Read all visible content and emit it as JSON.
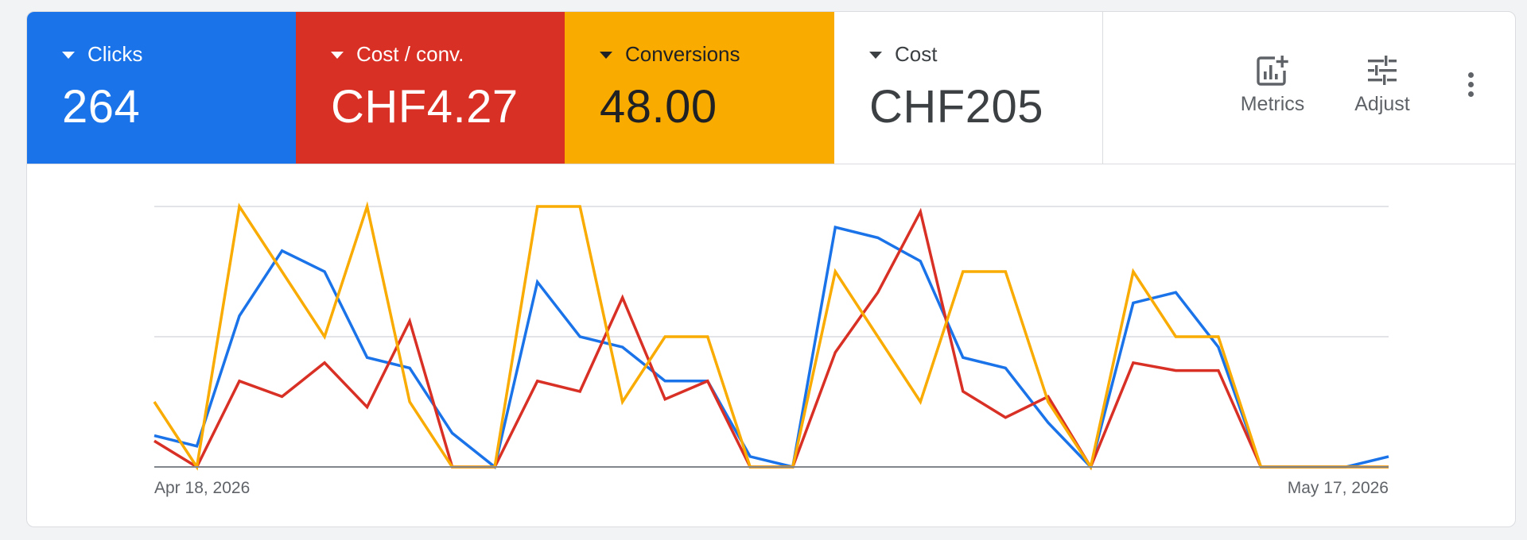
{
  "metrics": [
    {
      "label": "Clicks",
      "value": "264",
      "bg": "#1a73e8",
      "fg": "#ffffff"
    },
    {
      "label": "Cost / conv.",
      "value": "CHF4.27",
      "bg": "#d93025",
      "fg": "#ffffff"
    },
    {
      "label": "Conversions",
      "value": "48.00",
      "bg": "#f9ab00",
      "fg": "#202124"
    },
    {
      "label": "Cost",
      "value": "CHF205",
      "bg": "#ffffff",
      "fg": "#3c4043"
    }
  ],
  "actions": {
    "metrics_label": "Metrics",
    "adjust_label": "Adjust",
    "metrics_icon": "add-chart-icon",
    "adjust_icon": "tune-icon",
    "more_icon": "more-vert-icon"
  },
  "chart_data": {
    "type": "line",
    "x_start_label": "Apr 18, 2026",
    "x_end_label": "May 17, 2026",
    "ylim": [
      0,
      1
    ],
    "grid": true,
    "y_tick_labels": false,
    "series": [
      {
        "color": "#1a73e8",
        "values": [
          0.12,
          0.08,
          0.58,
          0.83,
          0.75,
          0.42,
          0.38,
          0.13,
          0.0,
          0.71,
          0.5,
          0.46,
          0.33,
          0.33,
          0.04,
          0.0,
          0.92,
          0.88,
          0.79,
          0.42,
          0.38,
          0.17,
          0.0,
          0.63,
          0.67,
          0.46,
          0.0,
          0.0,
          0.0,
          0.04
        ]
      },
      {
        "color": "#d93025",
        "values": [
          0.1,
          0.0,
          0.33,
          0.27,
          0.4,
          0.23,
          0.56,
          0.0,
          0.0,
          0.33,
          0.29,
          0.65,
          0.26,
          0.33,
          0.0,
          0.0,
          0.44,
          0.67,
          0.98,
          0.29,
          0.19,
          0.27,
          0.0,
          0.4,
          0.37,
          0.37,
          0.0,
          0.0,
          0.0,
          0.0
        ]
      },
      {
        "color": "#f9ab00",
        "values": [
          0.25,
          0.0,
          1.0,
          0.75,
          0.5,
          1.0,
          0.25,
          0.0,
          0.0,
          1.0,
          1.0,
          0.25,
          0.5,
          0.5,
          0.0,
          0.0,
          0.75,
          0.5,
          0.25,
          0.75,
          0.75,
          0.25,
          0.0,
          0.75,
          0.5,
          0.5,
          0.0,
          0.0,
          0.0,
          0.0
        ]
      }
    ]
  }
}
